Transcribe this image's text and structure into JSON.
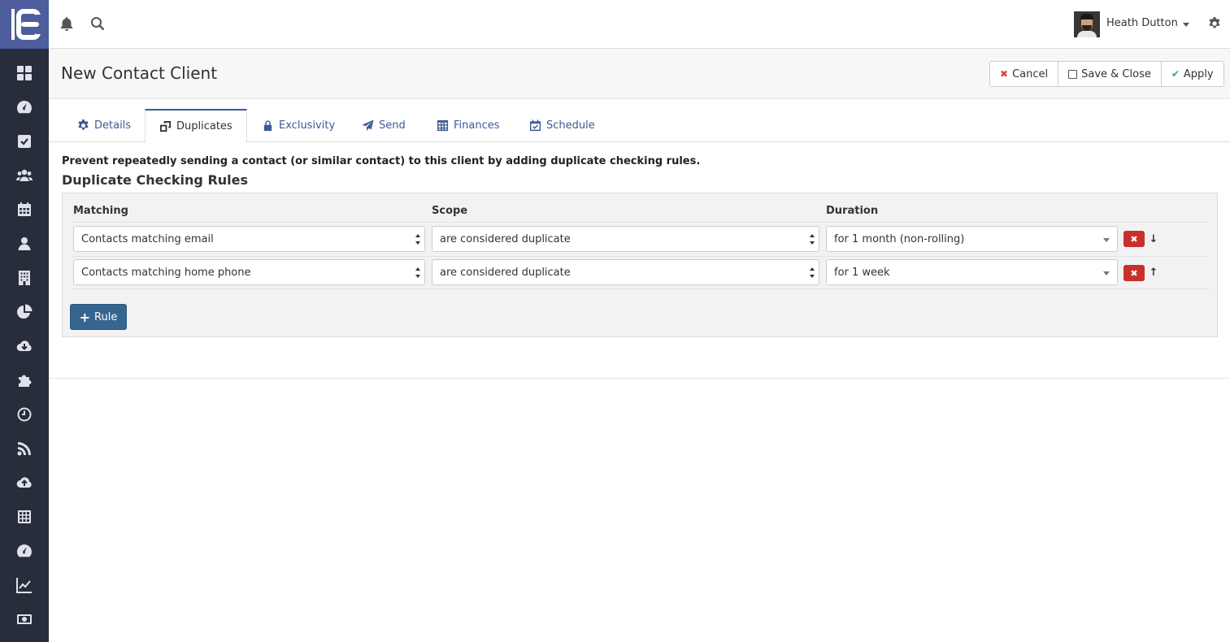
{
  "topbar": {
    "username": "Heath Dutton"
  },
  "sidebar": {
    "items": [
      "dashboard-icon",
      "gauge-icon",
      "checkbox-icon",
      "users-icon",
      "calendar-icon",
      "user-icon",
      "building-icon",
      "pie-chart-icon",
      "cloud-download-icon",
      "puzzle-icon",
      "clock-icon",
      "rss-icon",
      "cloud-upload-icon",
      "calculator-icon",
      "gauge-alt-icon",
      "line-chart-icon",
      "money-icon"
    ]
  },
  "header": {
    "title": "New Contact Client",
    "cancel_label": "Cancel",
    "save_close_label": "Save & Close",
    "apply_label": "Apply"
  },
  "tabs": [
    {
      "label": "Details",
      "icon": "gear-icon"
    },
    {
      "label": "Duplicates",
      "icon": "duplicate-icon"
    },
    {
      "label": "Exclusivity",
      "icon": "lock-icon"
    },
    {
      "label": "Send",
      "icon": "paper-plane-icon"
    },
    {
      "label": "Finances",
      "icon": "table-icon"
    },
    {
      "label": "Schedule",
      "icon": "calendar-check-icon"
    }
  ],
  "content": {
    "description": "Prevent repeatedly sending a contact (or similar contact) to this client by adding duplicate checking rules.",
    "section_title": "Duplicate Checking Rules",
    "columns": {
      "matching": "Matching",
      "scope": "Scope",
      "duration": "Duration"
    },
    "rules": [
      {
        "matching": "Contacts matching email",
        "scope": "are considered duplicate",
        "duration": "for 1 month (non-rolling)",
        "move": "down"
      },
      {
        "matching": "Contacts matching home phone",
        "scope": "are considered duplicate",
        "duration": "for 1 week",
        "move": "up"
      }
    ],
    "add_rule_label": "Rule"
  }
}
